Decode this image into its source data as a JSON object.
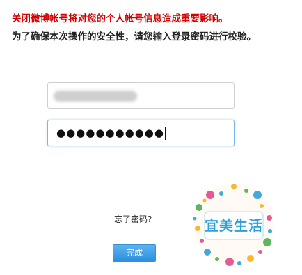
{
  "notice": {
    "warning": "关闭微博帐号将对您的个人帐号信息造成重要影响。",
    "instruction": "为了确保本次操作的安全性，请您输入登录密码进行校验。"
  },
  "form": {
    "password_masked": "●●●●●●●●●●●",
    "forgot_link": "忘了密码?",
    "submit_label": "完成"
  },
  "watermark": {
    "text": "宜美生活",
    "colors": {
      "primary": "#2f9fd6",
      "secondary": "#e24a88",
      "accent": "#f2b21c",
      "green": "#4caf50"
    }
  }
}
